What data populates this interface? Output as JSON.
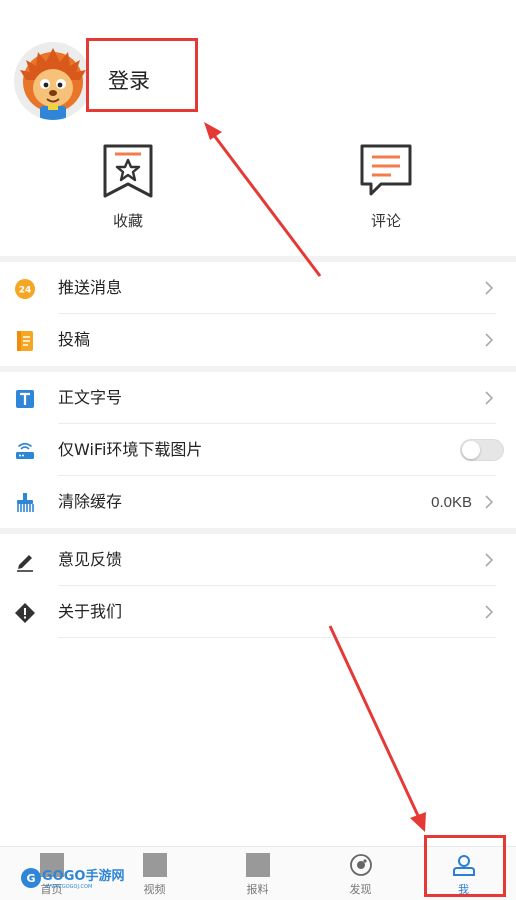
{
  "profile": {
    "login_label": "登录",
    "avatar": "lion-mascot-avatar"
  },
  "quick_actions": [
    {
      "label": "收藏",
      "icon": "bookmark-star-icon"
    },
    {
      "label": "评论",
      "icon": "comment-bubble-icon"
    }
  ],
  "menu": {
    "push": {
      "label": "推送消息",
      "icon": "push-24-icon"
    },
    "contribute": {
      "label": "投稿",
      "icon": "document-icon"
    },
    "font_size": {
      "label": "正文字号",
      "icon": "text-size-icon"
    },
    "wifi_images": {
      "label": "仅WiFi环境下载图片",
      "icon": "router-icon",
      "enabled": false
    },
    "clear_cache": {
      "label": "清除缓存",
      "value": "0.0KB",
      "icon": "broom-icon"
    },
    "feedback": {
      "label": "意见反馈",
      "icon": "pencil-icon"
    },
    "about": {
      "label": "关于我们",
      "icon": "diamond-info-icon"
    }
  },
  "tabs": [
    {
      "label": "首页",
      "icon": "home-icon"
    },
    {
      "label": "视频",
      "icon": "video-icon"
    },
    {
      "label": "报料",
      "icon": "report-icon"
    },
    {
      "label": "发现",
      "icon": "discover-icon"
    },
    {
      "label": "我",
      "icon": "user-icon",
      "active": true
    }
  ],
  "watermark": {
    "text": "GOGO手游网",
    "sub": "WWW.GOGOJ.COM"
  },
  "colors": {
    "accent": "#2a7fd4",
    "annotation_red": "#e53935",
    "icon_orange": "#f5a623"
  }
}
